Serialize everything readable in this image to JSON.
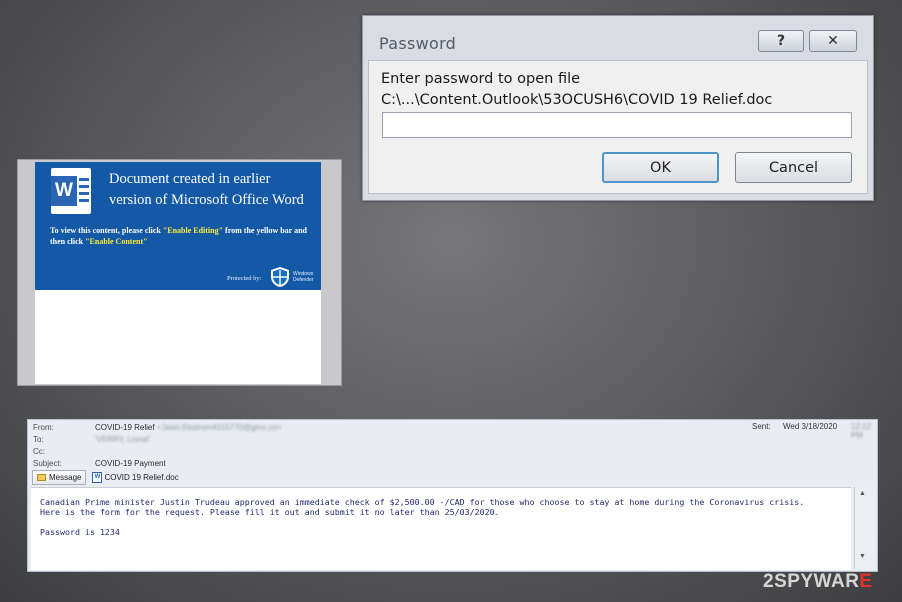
{
  "password_dialog": {
    "title": "Password",
    "help_button": "?",
    "close_button": "✕",
    "prompt_line1": "Enter password to open file",
    "prompt_line2": "C:\\...\\Content.Outlook\\53OCUSH6\\COVID 19 Relief.doc",
    "password_value": "",
    "ok_label": "OK",
    "cancel_label": "Cancel"
  },
  "word_doc": {
    "logo_letter": "W",
    "heading_line1": "Document created in earlier",
    "heading_line2": "version of Microsoft Office Word",
    "instr_part1": "To view this content, please click ",
    "instr_enable_editing": "\"Enable Editing\"",
    "instr_part2": " from the yellow bar and then click ",
    "instr_enable_content": "\"Enable Content\"",
    "protected_by": "Protected by:",
    "defender_line1": "Windows",
    "defender_line2": "Defender",
    "colors": {
      "banner": "#1459a5",
      "highlight": "#ffea3a"
    }
  },
  "email": {
    "from_label": "From:",
    "from_value": "COVID-19 Relief",
    "from_blurred": "<Jasin.Ekstrom4315770@gmx.co>",
    "to_label": "To:",
    "to_blurred": "'VERRY, Lionel'",
    "cc_label": "Cc:",
    "subject_label": "Subject:",
    "subject_value": "COVID-19 Payment",
    "sent_label": "Sent:",
    "sent_value": "Wed 3/18/2020",
    "sent_blurred": "12:12 PM",
    "message_tab": "Message",
    "attachment": "COVID 19 Relief.doc",
    "body_line1": "Canadian Prime minister Justin Trudeau approved an immediate check of $2,500.00 -/CAD for those who choose to stay at home during the Coronavirus crisis.",
    "body_line2": "Here is the form for the request. Please fill it out and submit it no later than 25/03/2020.",
    "body_password": "Password is 1234"
  },
  "watermark": {
    "part1": "2SPYWAR",
    "part2": "E"
  }
}
